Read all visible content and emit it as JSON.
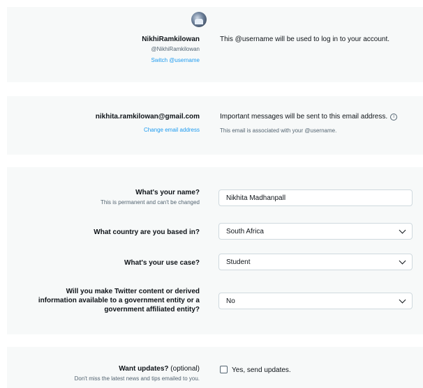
{
  "account": {
    "display_name": "NikhiRamkilowan",
    "handle": "@NikhiRamkilowan",
    "switch_label": "Switch @username",
    "username_note": "This @username will be used to log in to your account."
  },
  "email": {
    "address": "nikhita.ramkilowan@gmail.com",
    "change_label": "Change email address",
    "important_note": "Important messages will be sent to this email address.",
    "info_icon": "ⓘ",
    "associated_note": "This email is associated with your @username."
  },
  "form": {
    "name": {
      "label": "What's your name?",
      "sub": "This is permanent and can't be changed",
      "value": "Nikhita Madhanpall"
    },
    "country": {
      "label": "What country are you based in?",
      "value": "South Africa"
    },
    "use_case": {
      "label": "What's your use case?",
      "value": "Student"
    },
    "government": {
      "label_line1": "Will you make Twitter content or derived",
      "label_line2": "information available to a government entity or a",
      "label_line3": "government affiliated entity?",
      "value": "No"
    }
  },
  "updates": {
    "label": "Want updates?",
    "optional": "(optional)",
    "sub": "Don't miss the latest news and tips emailed to you.",
    "checkbox_label": "Yes, send updates."
  },
  "colors": {
    "card_bg": "#f7f9f9",
    "link": "#1d9bf0",
    "muted": "#536471",
    "text": "#0f1419"
  }
}
